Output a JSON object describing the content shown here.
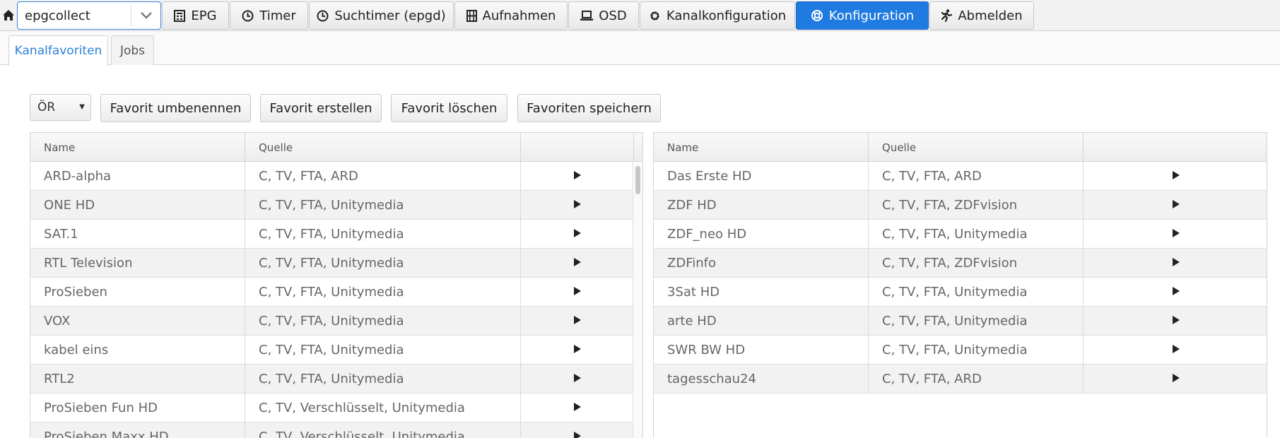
{
  "nav": {
    "search_value": "epgcollect",
    "buttons": [
      {
        "label": "EPG",
        "icon": "tv-guide-icon"
      },
      {
        "label": "Timer",
        "icon": "clock-icon"
      },
      {
        "label": "Suchtimer (epgd)",
        "icon": "clock-icon"
      },
      {
        "label": "Aufnahmen",
        "icon": "film-icon"
      },
      {
        "label": "OSD",
        "icon": "laptop-icon"
      },
      {
        "label": "Kanalkonfiguration",
        "icon": "gear-icon"
      },
      {
        "label": "Konfiguration",
        "icon": "lifebuoy-icon"
      },
      {
        "label": "Abmelden",
        "icon": "running-person-icon"
      }
    ],
    "active": "Konfiguration"
  },
  "tabs": [
    {
      "label": "Kanalfavoriten",
      "active": true
    },
    {
      "label": "Jobs",
      "active": false
    }
  ],
  "toolbar": {
    "select_value": "ÖR",
    "rename_label": "Favorit umbenennen",
    "create_label": "Favorit erstellen",
    "delete_label": "Favorit löschen",
    "save_label": "Favoriten speichern"
  },
  "left_table": {
    "headers": {
      "name": "Name",
      "source": "Quelle",
      "action": ""
    },
    "rows": [
      {
        "name": "ARD-alpha",
        "source": "C, TV, FTA, ARD"
      },
      {
        "name": "ONE HD",
        "source": "C, TV, FTA, Unitymedia"
      },
      {
        "name": "SAT.1",
        "source": "C, TV, FTA, Unitymedia"
      },
      {
        "name": "RTL Television",
        "source": "C, TV, FTA, Unitymedia"
      },
      {
        "name": "ProSieben",
        "source": "C, TV, FTA, Unitymedia"
      },
      {
        "name": "VOX",
        "source": "C, TV, FTA, Unitymedia"
      },
      {
        "name": "kabel eins",
        "source": "C, TV, FTA, Unitymedia"
      },
      {
        "name": "RTL2",
        "source": "C, TV, FTA, Unitymedia"
      },
      {
        "name": "ProSieben Fun HD",
        "source": "C, TV, Verschlüsselt, Unitymedia"
      },
      {
        "name": "ProSieben Maxx HD",
        "source": "C, TV, Verschlüsselt, Unitymedia"
      }
    ]
  },
  "right_table": {
    "headers": {
      "name": "Name",
      "source": "Quelle",
      "action": ""
    },
    "rows": [
      {
        "name": "Das Erste HD",
        "source": "C, TV, FTA, ARD"
      },
      {
        "name": "ZDF HD",
        "source": "C, TV, FTA, ZDFvision"
      },
      {
        "name": "ZDF_neo HD",
        "source": "C, TV, FTA, Unitymedia"
      },
      {
        "name": "ZDFinfo",
        "source": "C, TV, FTA, ZDFvision"
      },
      {
        "name": "3Sat HD",
        "source": "C, TV, FTA, Unitymedia"
      },
      {
        "name": "arte HD",
        "source": "C, TV, FTA, Unitymedia"
      },
      {
        "name": "SWR BW HD",
        "source": "C, TV, FTA, Unitymedia"
      },
      {
        "name": "tagesschau24",
        "source": "C, TV, FTA, ARD"
      }
    ]
  },
  "colors": {
    "accent": "#1f7be0",
    "tab_active_text": "#2b7fd8"
  }
}
